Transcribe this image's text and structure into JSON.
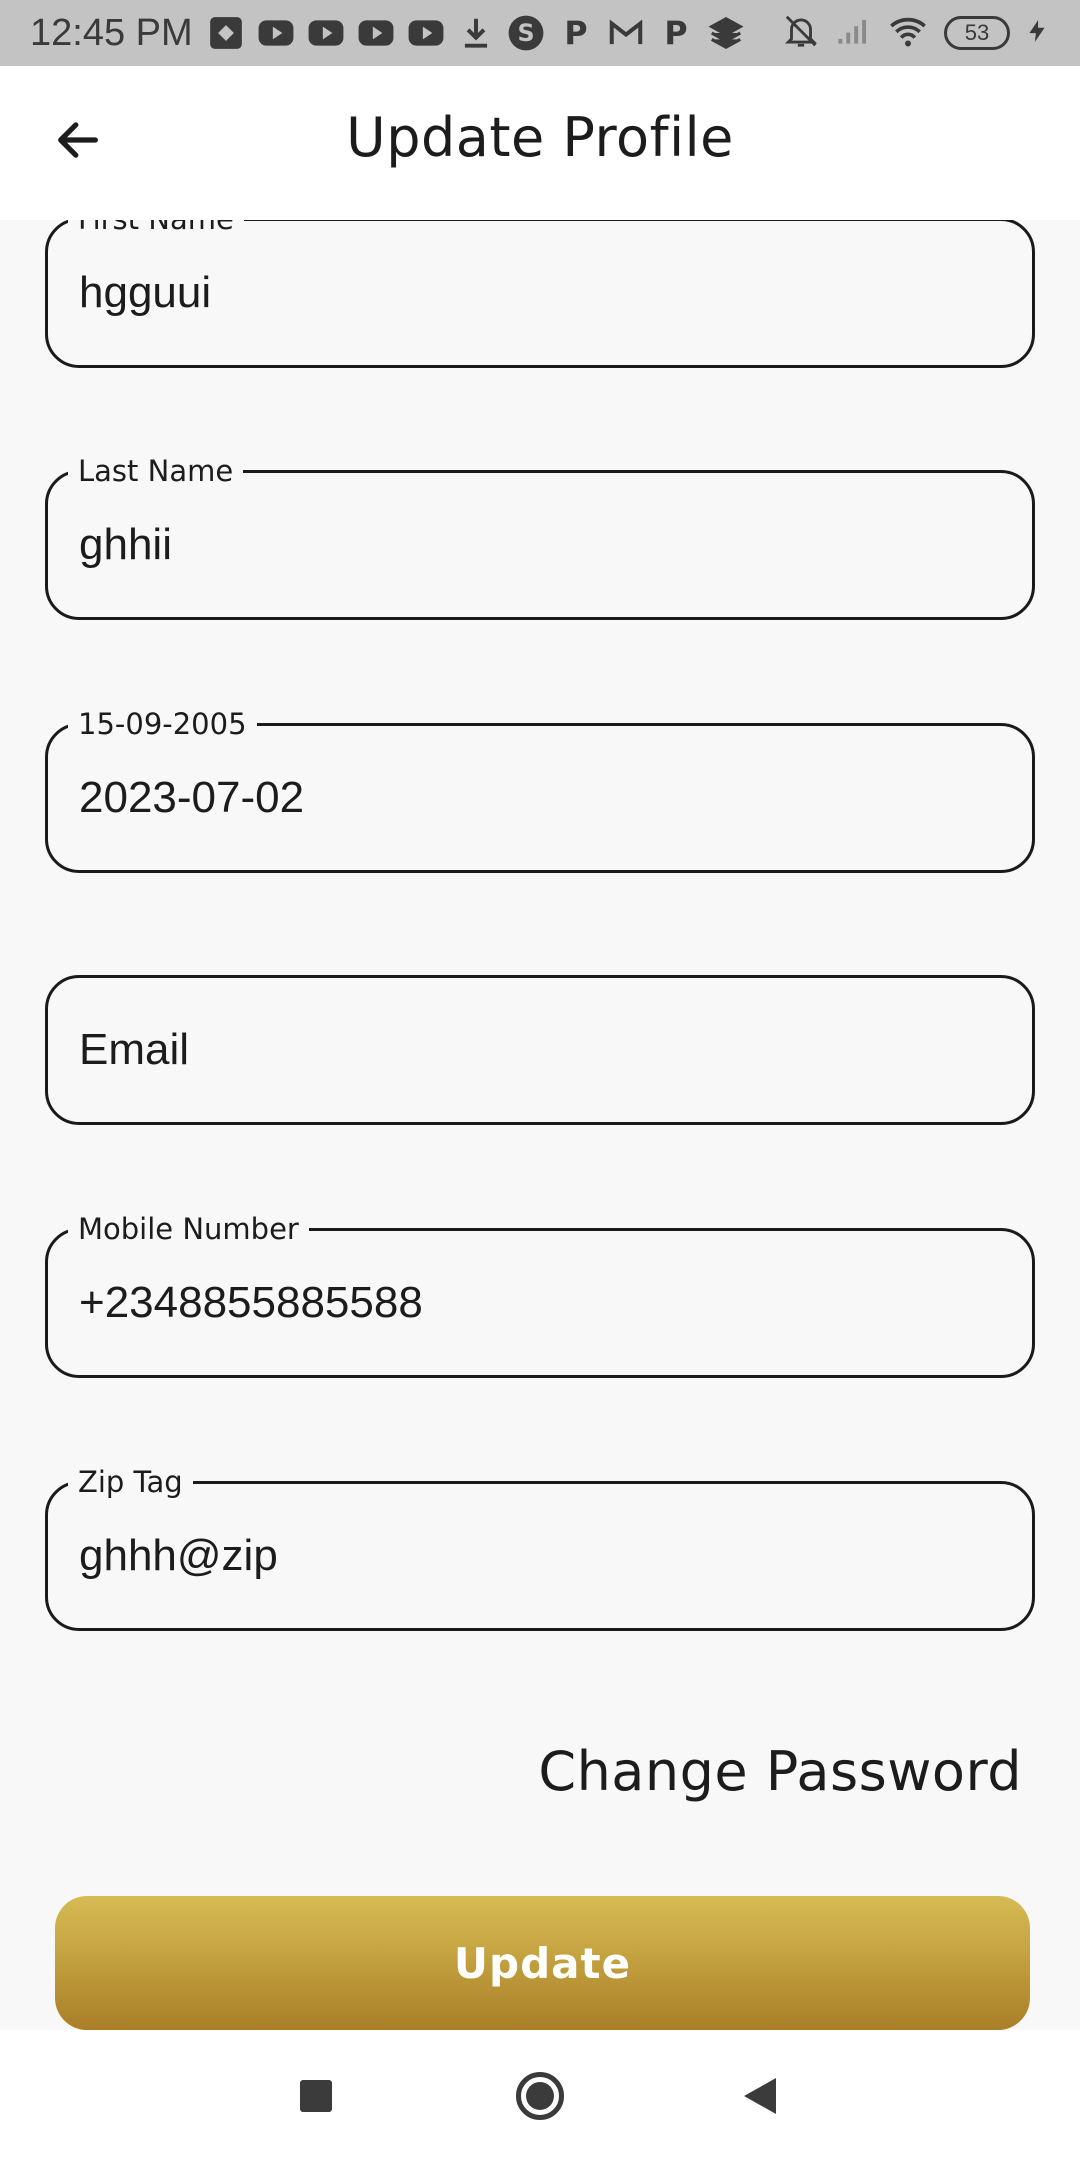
{
  "status_bar": {
    "time": "12:45 PM",
    "battery": "53",
    "notification_icons": [
      "sms-app-icon",
      "youtube-icon",
      "youtube-icon",
      "youtube-icon",
      "youtube-icon",
      "download-icon",
      "s-app-icon",
      "p-app-icon",
      "gmail-icon",
      "p-app-icon",
      "layers-app-icon"
    ],
    "right_icons": [
      "bell-off-icon",
      "signal-icon",
      "wifi-icon",
      "battery-icon",
      "charging-icon"
    ]
  },
  "header": {
    "title": "Update Profile",
    "back_icon": "arrow-left-icon"
  },
  "form": {
    "first_name": {
      "label": "First Name",
      "value": "hgguui"
    },
    "last_name": {
      "label": "Last Name",
      "value": "ghhii"
    },
    "date_of_birth": {
      "label": "15-09-2005",
      "value": "2023-07-02"
    },
    "email": {
      "placeholder": "Email"
    },
    "mobile_number": {
      "label": "Mobile Number",
      "value": "+2348855885588"
    },
    "zip_tag": {
      "label": "Zip Tag",
      "value": "ghhh@zip"
    }
  },
  "actions": {
    "change_password": "Change Password",
    "update": "Update"
  },
  "colors": {
    "accent_top": "#d6bb54",
    "accent_bottom": "#a97e27",
    "field_border": "#1a1a1a",
    "background": "#f8f8f8"
  },
  "nav_bar": {
    "icons": [
      "recent-apps-icon",
      "home-icon",
      "back-triangle-icon"
    ]
  }
}
